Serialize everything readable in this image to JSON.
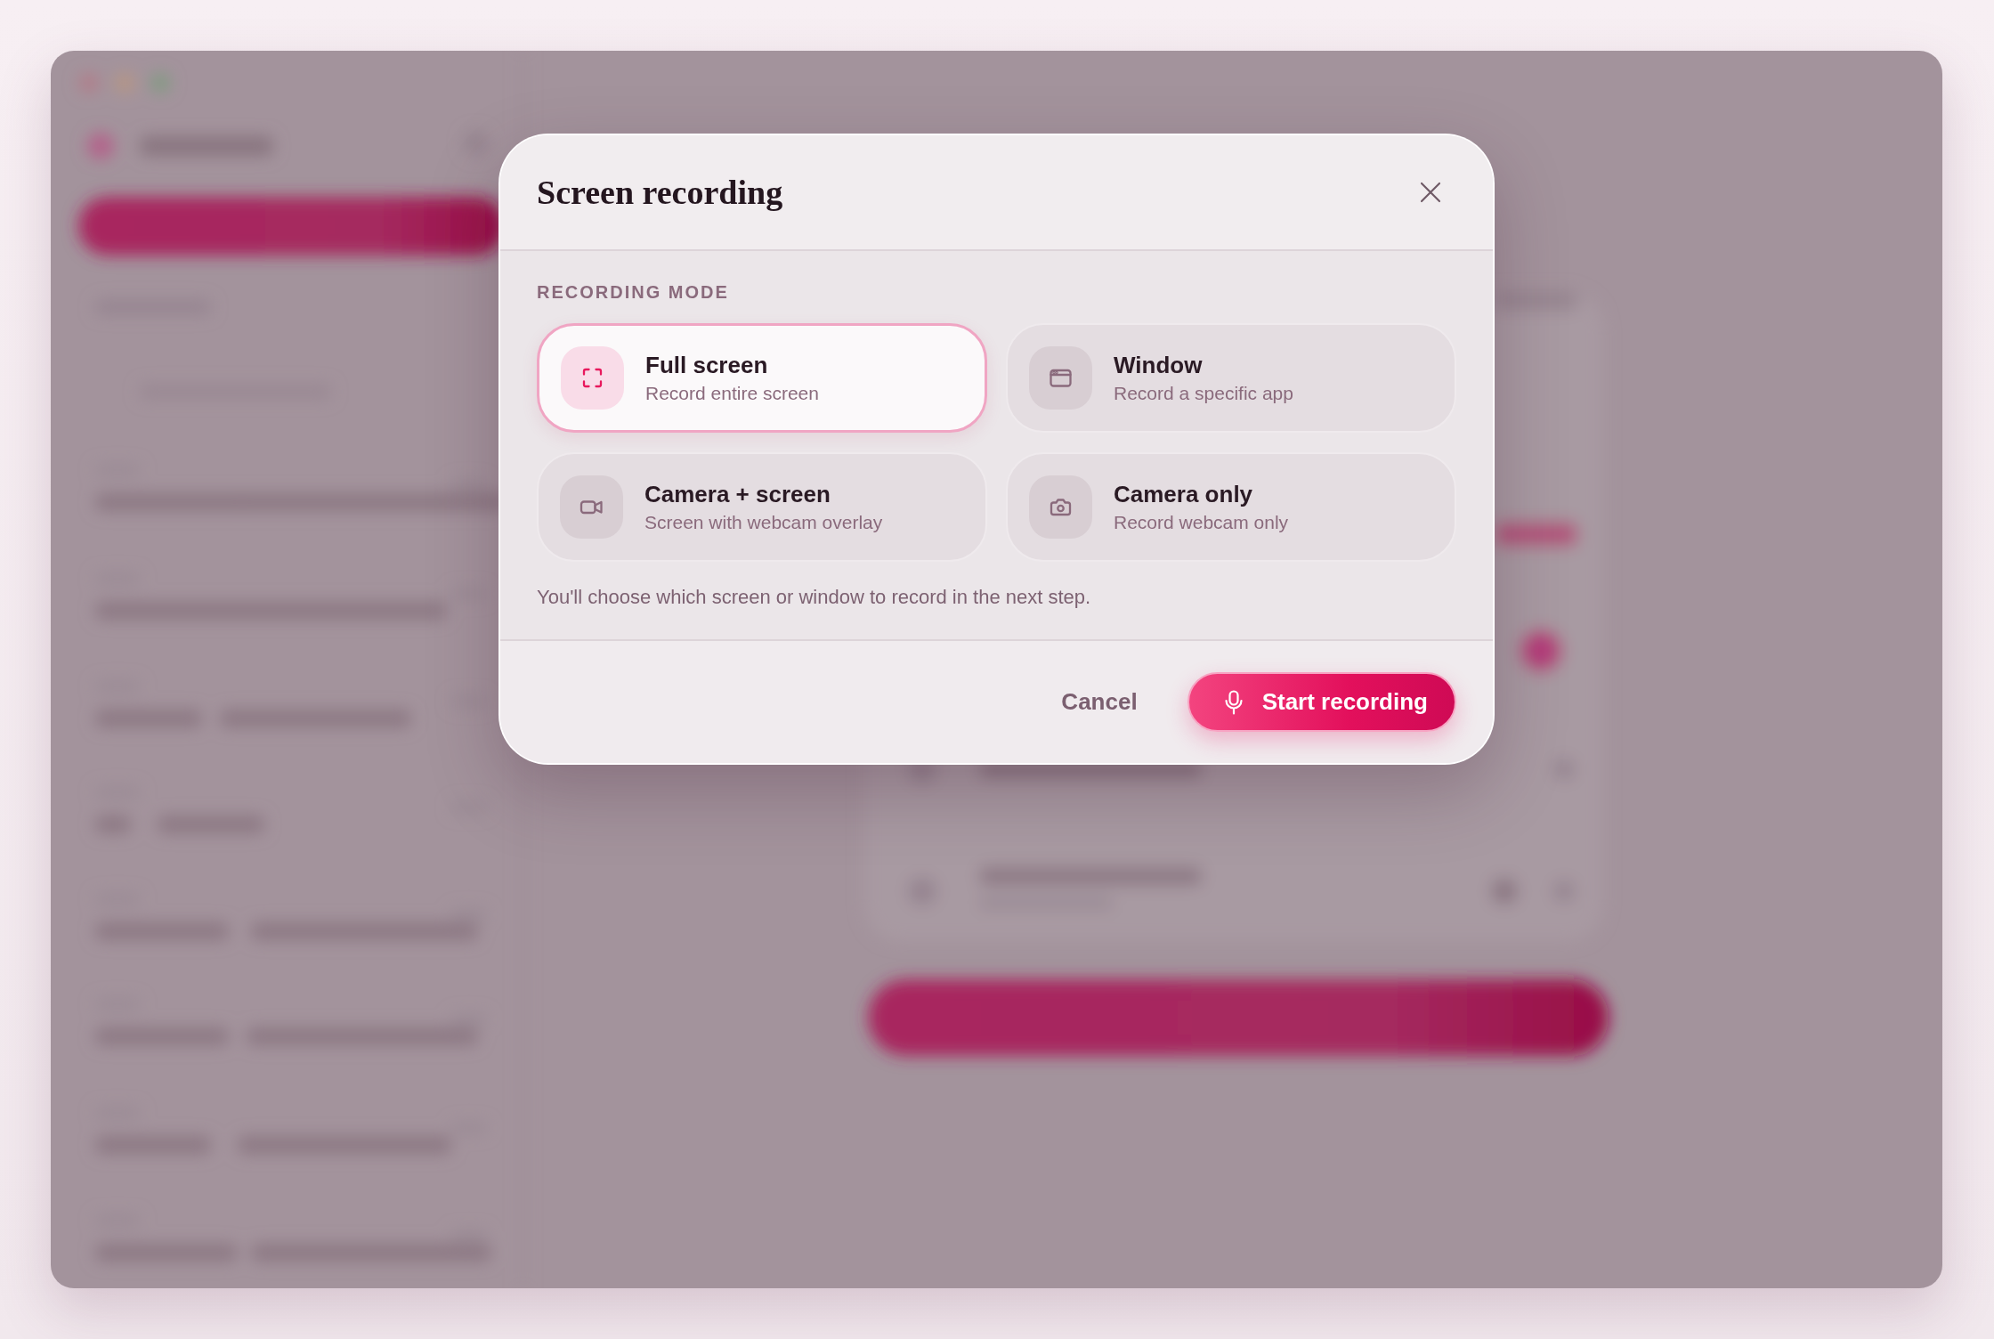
{
  "dialog": {
    "title": "Screen recording",
    "section_label": "RECORDING MODE",
    "modes": [
      {
        "kind": "fullscreen",
        "title": "Full screen",
        "subtitle": "Record entire screen",
        "selected": true
      },
      {
        "kind": "window",
        "title": "Window",
        "subtitle": "Record a specific app",
        "selected": false
      },
      {
        "kind": "camera_screen",
        "title": "Camera + screen",
        "subtitle": "Screen with webcam overlay",
        "selected": false
      },
      {
        "kind": "camera",
        "title": "Camera only",
        "subtitle": "Record webcam only",
        "selected": false
      }
    ],
    "note": "You'll choose which screen or window to record in the next step.",
    "cancel_label": "Cancel",
    "primary_label": "Start recording"
  }
}
